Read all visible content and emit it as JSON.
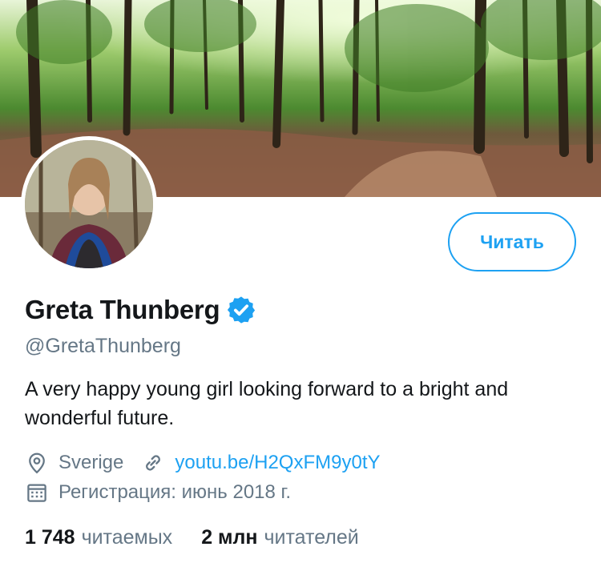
{
  "profile": {
    "display_name": "Greta Thunberg",
    "handle": "@GretaThunberg",
    "bio": "A very happy young girl looking forward to a bright and wonderful future.",
    "location": "Sverige",
    "link": "youtu.be/H2QxFM9y0tY",
    "joined": "Регистрация: июнь 2018 г.",
    "verified": true
  },
  "actions": {
    "follow_label": "Читать"
  },
  "stats": {
    "following_count": "1 748",
    "following_label": "читаемых",
    "followers_count": "2 млн",
    "followers_label": "читателей"
  },
  "icons": {
    "location": "map-pin-icon",
    "link": "link-icon",
    "calendar": "calendar-icon",
    "verified": "verified-badge-icon"
  },
  "colors": {
    "accent": "#1da1f2",
    "secondary_text": "#657786",
    "primary_text": "#14171a"
  }
}
